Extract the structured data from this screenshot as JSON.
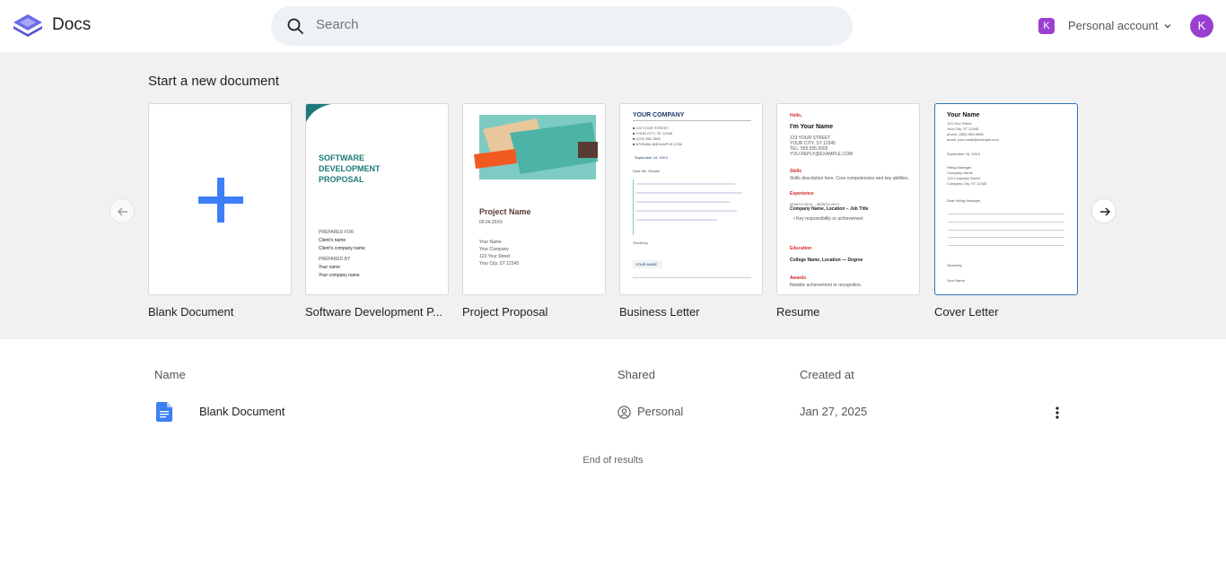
{
  "app": {
    "title": "Docs"
  },
  "search": {
    "placeholder": "Search"
  },
  "account": {
    "badge": "K",
    "label": "Personal account",
    "avatar": "K"
  },
  "templates": {
    "heading": "Start a new document",
    "items": [
      {
        "label": "Blank Document"
      },
      {
        "label": "Software Development P...",
        "title_lines": [
          "SOFTWARE",
          "DEVELOPMENT",
          "PROPOSAL"
        ],
        "prepared_for": "PREPARED FOR",
        "client_name": "Client's name",
        "client_company": "Client's company name",
        "prepared_by": "PREPARED BY",
        "your_name": "Your name",
        "your_company": "Your company name"
      },
      {
        "label": "Project Proposal",
        "title": "Project Name",
        "date": "09.04.20XX",
        "lines": [
          "Your Name",
          "Your Company",
          "123 Your Street",
          "Your City, ST 12345"
        ]
      },
      {
        "label": "Business Letter",
        "company": "YOUR COMPANY",
        "lines": [
          "123 YOUR STREET",
          "YOUR CITY, ST 12345",
          "(123) 456-7890",
          "MYEMAIL@EXAMPLE.COM"
        ],
        "date": "September 24, 20XX",
        "greeting": "Dear Ms. Reader",
        "sign": "Sincerely,",
        "name": "YOUR NAME"
      },
      {
        "label": "Resume",
        "hello": "Hello,",
        "name": "I'm Your Name",
        "contact": [
          "123 YOUR STREET",
          "YOUR CITY, ST 12345",
          "TEL: 555.555.5555",
          "YOU.REPLY@EXAMPLE.COM"
        ],
        "skills_h": "Skills",
        "skills": "Skills description here. Core competencies and key abilities.",
        "exp_h": "Experience",
        "exp_dates": "MONTH 20XX – MONTH 20YY",
        "exp_role": "Company Name, Location – Job Title",
        "exp_bullet": "Key responsibility or achievement",
        "edu_h": "Education",
        "edu": "College Name, Location — Degree",
        "awards_h": "Awards",
        "awards": "Notable achievement or recognition."
      },
      {
        "label": "Cover Letter",
        "name": "Your Name",
        "contact": [
          "123 Your Street",
          "Your City, ST 12345",
          "phone: (555) 555-5555",
          "email: your.email@example.com"
        ],
        "date": "September 24, 20XX",
        "recipient": [
          "Hiring Manager",
          "Company Name",
          "123 Company Street",
          "Company City, ST 12345"
        ],
        "greeting": "Dear Hiring Manager,",
        "sign": "Sincerely,",
        "sign_name": "Your Name"
      }
    ]
  },
  "list": {
    "columns": {
      "name": "Name",
      "shared": "Shared",
      "created": "Created at"
    },
    "rows": [
      {
        "name": "Blank Document",
        "shared": "Personal",
        "created": "Jan 27, 2025"
      }
    ],
    "end": "End of results"
  },
  "colors": {
    "accent": "#3d7ff5",
    "teal": "#1a7a78",
    "avatar": "#9b3fd1",
    "resume_red": "#d12a2a"
  }
}
